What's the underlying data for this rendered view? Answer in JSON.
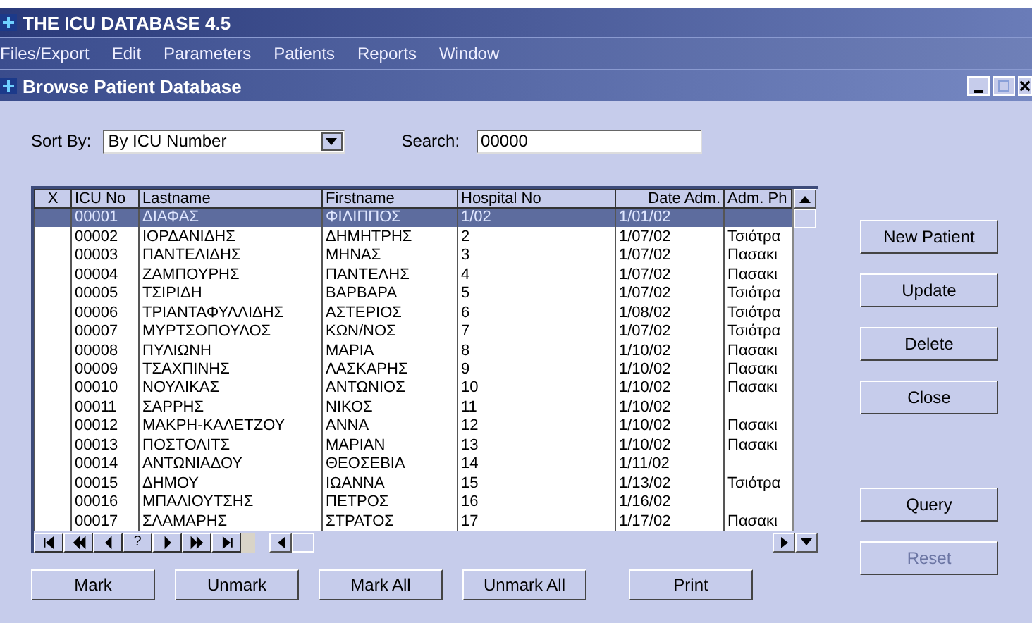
{
  "app_window": {
    "title": "THE ICU DATABASE 4.5"
  },
  "menu": [
    "Files/Export",
    "Edit",
    "Parameters",
    "Patients",
    "Reports",
    "Window"
  ],
  "child_window": {
    "title": "Browse Patient Database"
  },
  "sort_by": {
    "label": "Sort By:",
    "value": "By ICU Number"
  },
  "search": {
    "label": "Search:",
    "value": "00000"
  },
  "table": {
    "columns": [
      "X",
      "ICU No",
      "Lastname",
      "Firstname",
      "Hospital No",
      "Date Adm.",
      "Adm. Ph"
    ],
    "rows": [
      {
        "selected": true,
        "cells": [
          "",
          "00001",
          "ΔΙΑΦΑΣ",
          "ΦΙΛΙΠΠΟΣ",
          "1/02",
          "1/01/02",
          ""
        ]
      },
      {
        "selected": false,
        "cells": [
          "",
          "00002",
          "ΙΟΡΔΑΝΙΔΗΣ",
          "ΔΗΜΗΤΡΗΣ",
          "2",
          "1/07/02",
          "Τσιότρα"
        ]
      },
      {
        "selected": false,
        "cells": [
          "",
          "00003",
          "ΠΑΝΤΕΛΙΔΗΣ",
          "ΜΗΝΑΣ",
          "3",
          "1/07/02",
          "Πασακι"
        ]
      },
      {
        "selected": false,
        "cells": [
          "",
          "00004",
          "ΖΑΜΠΟΥΡΗΣ",
          "ΠΑΝΤΕΛΗΣ",
          "4",
          "1/07/02",
          "Πασακι"
        ]
      },
      {
        "selected": false,
        "cells": [
          "",
          "00005",
          "ΤΣΙΡΙΔΗ",
          "ΒΑΡΒΑΡΑ",
          "5",
          "1/07/02",
          "Τσιότρα"
        ]
      },
      {
        "selected": false,
        "cells": [
          "",
          "00006",
          "ΤΡΙΑΝΤΑΦΥΛΛΙΔΗΣ",
          "ΑΣΤΕΡΙΟΣ",
          "6",
          "1/08/02",
          "Τσιότρα"
        ]
      },
      {
        "selected": false,
        "cells": [
          "",
          "00007",
          "ΜΥΡΤΣΟΠΟΥΛΟΣ",
          "ΚΩΝ/ΝΟΣ",
          "7",
          "1/07/02",
          "Τσιότρα"
        ]
      },
      {
        "selected": false,
        "cells": [
          "",
          "00008",
          "ΠΥΛΙΩΝΗ",
          "ΜΑΡΙΑ",
          "8",
          "1/10/02",
          "Πασακι"
        ]
      },
      {
        "selected": false,
        "cells": [
          "",
          "00009",
          "ΤΣΑΧΠΙΝΗΣ",
          "ΛΑΣΚΑΡΗΣ",
          "9",
          "1/10/02",
          "Πασακι"
        ]
      },
      {
        "selected": false,
        "cells": [
          "",
          "00010",
          "ΝΟΥΛΙΚΑΣ",
          "ΑΝΤΩΝΙΟΣ",
          "10",
          "1/10/02",
          "Πασακι"
        ]
      },
      {
        "selected": false,
        "cells": [
          "",
          "00011",
          "ΣΑΡΡΗΣ",
          "ΝΙΚΟΣ",
          "11",
          "1/10/02",
          ""
        ]
      },
      {
        "selected": false,
        "cells": [
          "",
          "00012",
          "ΜΑΚΡΗ-ΚΑΛΕΤΖΟΥ",
          "ΑΝΝΑ",
          "12",
          "1/10/02",
          "Πασακι"
        ]
      },
      {
        "selected": false,
        "cells": [
          "",
          "00013",
          "ΠΟΣΤΟΛΙΤΣ",
          "ΜΑΡΙΑΝ",
          "13",
          "1/10/02",
          "Πασακι"
        ]
      },
      {
        "selected": false,
        "cells": [
          "",
          "00014",
          "ΑΝΤΩΝΙΑΔΟΥ",
          "ΘΕΟΣΕΒΙΑ",
          "14",
          "1/11/02",
          ""
        ]
      },
      {
        "selected": false,
        "cells": [
          "",
          "00015",
          "ΔΗΜΟΥ",
          "ΙΩΑΝΝΑ",
          "15",
          "1/13/02",
          "Τσιότρα"
        ]
      },
      {
        "selected": false,
        "cells": [
          "",
          "00016",
          "ΜΠΑΛΙΟΥΤΣΗΣ",
          "ΠΕΤΡΟΣ",
          "16",
          "1/16/02",
          ""
        ]
      },
      {
        "selected": false,
        "cells": [
          "",
          "00017",
          "ΣΛΑΜΑΡΗΣ",
          "ΣΤΡΑΤΟΣ",
          "17",
          "1/17/02",
          "Πασακι"
        ]
      }
    ]
  },
  "navigator": [
    {
      "kind": "first"
    },
    {
      "kind": "prev-page"
    },
    {
      "kind": "prev"
    },
    {
      "kind": "find",
      "label": "?"
    },
    {
      "kind": "next"
    },
    {
      "kind": "next-page"
    },
    {
      "kind": "last"
    }
  ],
  "side_buttons": [
    {
      "label": "New Patient",
      "disabled": false
    },
    {
      "label": "Update",
      "disabled": false
    },
    {
      "label": "Delete",
      "disabled": false
    },
    {
      "label": "Close",
      "disabled": false
    },
    {
      "label": "Query",
      "disabled": false
    },
    {
      "label": "Reset",
      "disabled": true
    }
  ],
  "bottom_buttons": [
    "Mark",
    "Unmark",
    "Mark All",
    "Unmark All",
    "Print"
  ]
}
